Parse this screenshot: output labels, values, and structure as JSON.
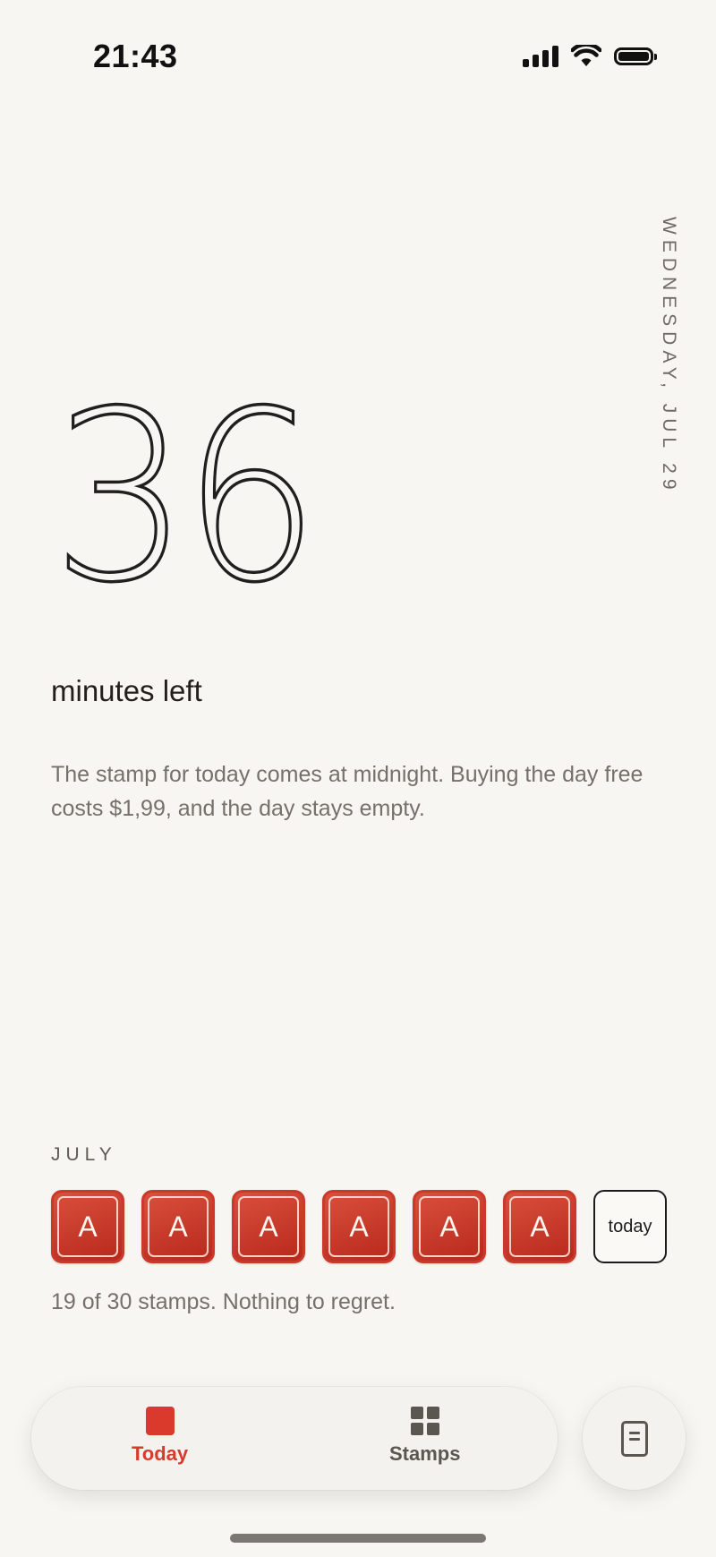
{
  "status_bar": {
    "time": "21:43",
    "icons": [
      "signal-icon",
      "wifi-icon",
      "battery-icon"
    ]
  },
  "header": {
    "date": "WEDNESDAY, JUL 29"
  },
  "countdown": {
    "minutes": "36",
    "label": "minutes left"
  },
  "description": "The stamp for today comes at midnight. Buying the day free costs $1,99, and the day stays empty.",
  "month": {
    "name": "JULY",
    "stamps": [
      {
        "letter": "A"
      },
      {
        "letter": "A"
      },
      {
        "letter": "A"
      },
      {
        "letter": "A"
      },
      {
        "letter": "A"
      },
      {
        "letter": "A"
      }
    ],
    "today_label": "today",
    "summary": "19 of 30 stamps. Nothing to regret."
  },
  "tab_bar": {
    "tabs": [
      {
        "label": "Today",
        "icon": "square-icon",
        "active": true
      },
      {
        "label": "Stamps",
        "icon": "grid-icon",
        "active": false
      }
    ],
    "side_button_icon": "document-icon"
  },
  "colors": {
    "background": "#f8f6f2",
    "accent": "#d93a2b",
    "text_primary": "#221f1c",
    "text_secondary": "#75706a"
  }
}
